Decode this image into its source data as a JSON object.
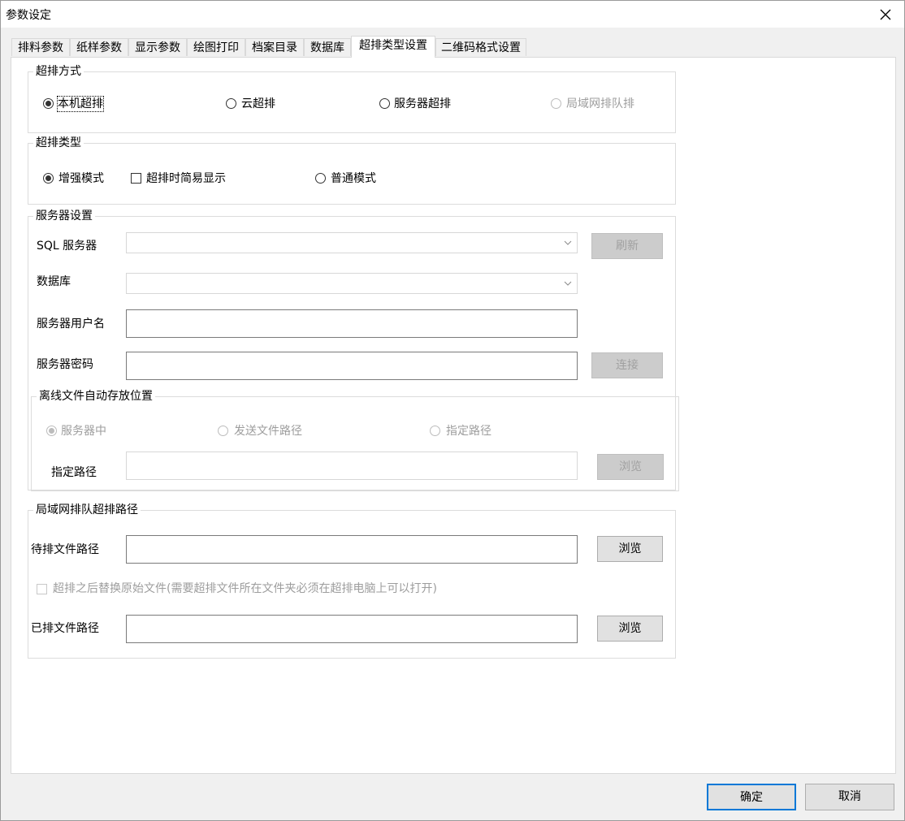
{
  "window": {
    "title": "参数设定"
  },
  "tabs": [
    {
      "label": "排料参数"
    },
    {
      "label": "纸样参数"
    },
    {
      "label": "显示参数"
    },
    {
      "label": "绘图打印"
    },
    {
      "label": "档案目录"
    },
    {
      "label": "数据库"
    },
    {
      "label": "超排类型设置",
      "active": true
    },
    {
      "label": "二维码格式设置"
    }
  ],
  "mode_group": {
    "title": "超排方式",
    "options": [
      {
        "label": "本机超排",
        "checked": true,
        "enabled": true
      },
      {
        "label": "云超排",
        "checked": false,
        "enabled": true
      },
      {
        "label": "服务器超排",
        "checked": false,
        "enabled": true
      },
      {
        "label": "局域网排队排",
        "checked": false,
        "enabled": false
      }
    ]
  },
  "type_group": {
    "title": "超排类型",
    "enhanced_label": "增强模式",
    "enhanced_checked": true,
    "simple_display_label": "超排时简易显示",
    "simple_display_checked": false,
    "normal_label": "普通模式",
    "normal_checked": false
  },
  "server_group": {
    "title": "服务器设置",
    "sql_server_label": "SQL 服务器",
    "sql_server_value": "",
    "refresh_button": "刷新",
    "database_label": "数据库",
    "database_value": "",
    "username_label": "服务器用户名",
    "username_value": "",
    "password_label": "服务器密码",
    "password_value": "",
    "connect_button": "连接"
  },
  "offline_group": {
    "title": "离线文件自动存放位置",
    "options": [
      {
        "label": "服务器中",
        "checked": true
      },
      {
        "label": "发送文件路径",
        "checked": false
      },
      {
        "label": "指定路径",
        "checked": false
      }
    ],
    "path_label": "指定路径",
    "path_value": "",
    "browse_button": "浏览"
  },
  "lan_group": {
    "title": "局域网排队超排路径",
    "pending_label": "待排文件路径",
    "pending_value": "",
    "pending_browse": "浏览",
    "replace_label": "超排之后替换原始文件(需要超排文件所在文件夹必须在超排电脑上可以打开)",
    "replace_checked": false,
    "done_label": "已排文件路径",
    "done_value": "",
    "done_browse": "浏览"
  },
  "footer": {
    "ok_button": "确定",
    "cancel_button": "取消"
  },
  "icons": {
    "close": "close-icon",
    "dropdown": "chevron-down-icon"
  },
  "colors": {
    "accent": "#0078d7",
    "disabled_text": "#9d9d9d",
    "disabled_button": "#cccccc"
  }
}
